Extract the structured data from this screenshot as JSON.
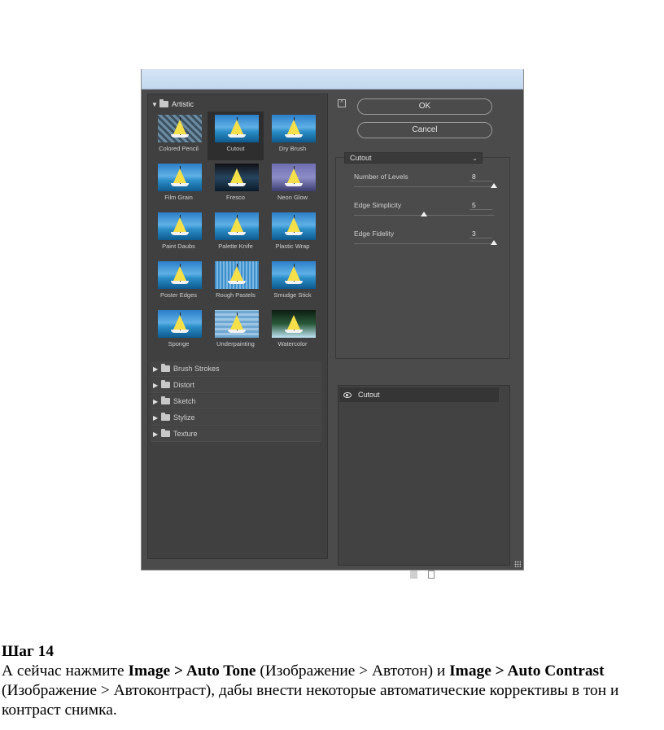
{
  "dialog": {
    "gallery": {
      "open_category": "Artistic",
      "filters": [
        {
          "label": "Colored Pencil",
          "variant": "v-pencil"
        },
        {
          "label": "Cutout",
          "variant": "",
          "selected": true
        },
        {
          "label": "Dry Brush",
          "variant": ""
        },
        {
          "label": "Film Grain",
          "variant": ""
        },
        {
          "label": "Fresco",
          "variant": "v-fresco"
        },
        {
          "label": "Neon Glow",
          "variant": "v-neon"
        },
        {
          "label": "Paint Daubs",
          "variant": ""
        },
        {
          "label": "Palette Knife",
          "variant": ""
        },
        {
          "label": "Plastic Wrap",
          "variant": ""
        },
        {
          "label": "Poster Edges",
          "variant": ""
        },
        {
          "label": "Rough Pastels",
          "variant": "v-rough"
        },
        {
          "label": "Smudge Stick",
          "variant": ""
        },
        {
          "label": "Sponge",
          "variant": ""
        },
        {
          "label": "Underpainting",
          "variant": "v-under"
        },
        {
          "label": "Watercolor",
          "variant": "v-water"
        }
      ],
      "categories": [
        "Brush Strokes",
        "Distort",
        "Sketch",
        "Stylize",
        "Texture"
      ]
    },
    "buttons": {
      "ok": "OK",
      "cancel": "Cancel"
    },
    "filter_select": "Cutout",
    "params": [
      {
        "label": "Number of Levels",
        "value": "8",
        "fraction": 1.0
      },
      {
        "label": "Edge Simplicity",
        "value": "5",
        "fraction": 0.5
      },
      {
        "label": "Edge Fidelity",
        "value": "3",
        "fraction": 1.0
      }
    ],
    "layer": "Cutout"
  },
  "doc": {
    "step": "Шаг 14",
    "p1": "А сейчас нажмите ",
    "b1": "Image > Auto Tone",
    "p2": " (Изображение > Автотон) и ",
    "b2": "Image > Auto Contrast",
    "p3": " (Изображение > Автоконтраст), дабы внести некоторые автоматические коррективы в тон и контраст снимка."
  }
}
